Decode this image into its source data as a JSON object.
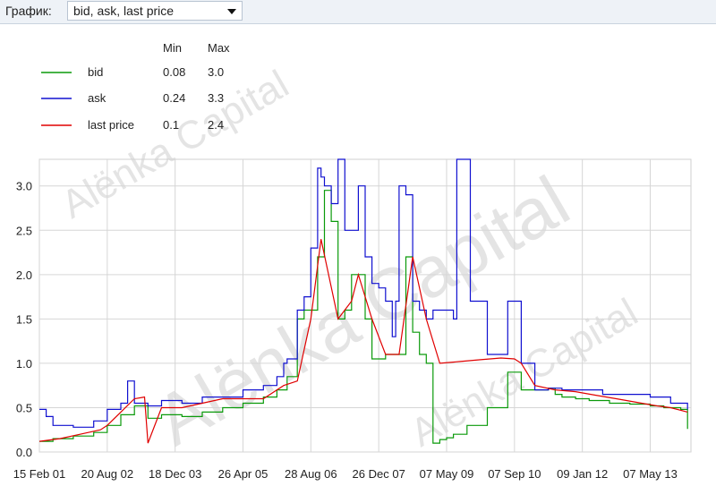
{
  "header": {
    "label": "График:",
    "selected": "bid, ask, last price"
  },
  "legend": {
    "min_header": "Min",
    "max_header": "Max",
    "rows": [
      {
        "name": "bid",
        "min": "0.08",
        "max": "3.0",
        "color": "#0a9a0a"
      },
      {
        "name": "ask",
        "min": "0.24",
        "max": "3.3",
        "color": "#1010d0"
      },
      {
        "name": "last price",
        "min": "0.1",
        "max": "2.4",
        "color": "#e00000"
      }
    ]
  },
  "watermark": "Alënka Capital",
  "chart_data": {
    "type": "line",
    "x_tick_labels": [
      "15 Feb 01",
      "20 Aug 02",
      "18 Dec 03",
      "26 Apr 05",
      "28 Aug 06",
      "26 Dec 07",
      "07 May 09",
      "07 Sep 10",
      "09 Jan 12",
      "07 May 13"
    ],
    "y_ticks": [
      0.0,
      0.5,
      1.0,
      1.5,
      2.0,
      2.5,
      3.0
    ],
    "y_tick_labels": [
      "0.0",
      "0.5",
      "1.0",
      "1.5",
      "2.0",
      "2.5",
      "3.0"
    ],
    "ylim": [
      0,
      3.3
    ],
    "xlim": [
      0,
      9.6
    ],
    "grid": true,
    "series": [
      {
        "name": "bid",
        "color": "#0a9a0a",
        "x": [
          0.0,
          0.2,
          0.5,
          0.8,
          1.0,
          1.2,
          1.4,
          1.6,
          1.8,
          2.1,
          2.4,
          2.7,
          3.0,
          3.3,
          3.5,
          3.65,
          3.8,
          3.9,
          4.0,
          4.1,
          4.2,
          4.3,
          4.4,
          4.5,
          4.6,
          4.7,
          4.8,
          4.9,
          5.0,
          5.1,
          5.2,
          5.3,
          5.4,
          5.5,
          5.6,
          5.7,
          5.8,
          5.9,
          6.0,
          6.1,
          6.3,
          6.6,
          6.9,
          7.1,
          7.3,
          7.5,
          7.6,
          7.7,
          7.9,
          8.1,
          8.4,
          8.7,
          9.0,
          9.2,
          9.45,
          9.55
        ],
        "y": [
          0.12,
          0.15,
          0.18,
          0.22,
          0.3,
          0.42,
          0.52,
          0.38,
          0.42,
          0.4,
          0.45,
          0.5,
          0.55,
          0.62,
          0.7,
          0.85,
          1.5,
          1.6,
          1.6,
          2.2,
          2.95,
          2.6,
          1.5,
          1.6,
          2.0,
          2.0,
          1.5,
          1.05,
          1.05,
          1.1,
          1.1,
          1.1,
          2.2,
          1.35,
          1.1,
          1.0,
          0.1,
          0.14,
          0.16,
          0.2,
          0.3,
          0.5,
          0.9,
          0.7,
          0.7,
          0.72,
          0.65,
          0.62,
          0.6,
          0.58,
          0.55,
          0.54,
          0.52,
          0.5,
          0.48,
          0.26
        ]
      },
      {
        "name": "ask",
        "color": "#1010d0",
        "x": [
          0.0,
          0.1,
          0.2,
          0.5,
          0.8,
          1.0,
          1.2,
          1.3,
          1.4,
          1.6,
          1.8,
          2.1,
          2.4,
          2.7,
          3.0,
          3.3,
          3.5,
          3.6,
          3.65,
          3.8,
          3.9,
          4.0,
          4.1,
          4.15,
          4.2,
          4.3,
          4.4,
          4.5,
          4.6,
          4.7,
          4.8,
          4.9,
          5.0,
          5.1,
          5.2,
          5.25,
          5.3,
          5.4,
          5.5,
          5.6,
          5.7,
          5.8,
          6.0,
          6.1,
          6.15,
          6.3,
          6.35,
          6.6,
          6.8,
          6.9,
          7.0,
          7.1,
          7.3,
          7.5,
          7.7,
          8.0,
          8.3,
          8.6,
          9.0,
          9.3,
          9.55
        ],
        "y": [
          0.48,
          0.4,
          0.3,
          0.28,
          0.35,
          0.48,
          0.55,
          0.8,
          0.55,
          0.52,
          0.58,
          0.55,
          0.62,
          0.62,
          0.7,
          0.75,
          0.85,
          1.0,
          1.05,
          1.6,
          1.75,
          2.3,
          3.2,
          3.1,
          3.0,
          2.8,
          3.3,
          2.5,
          2.5,
          3.0,
          2.2,
          1.9,
          1.85,
          1.7,
          1.3,
          1.7,
          3.0,
          2.9,
          1.7,
          1.6,
          1.5,
          1.6,
          1.6,
          1.5,
          3.3,
          3.3,
          1.7,
          1.1,
          1.1,
          1.7,
          1.7,
          1.0,
          0.7,
          0.72,
          0.7,
          0.7,
          0.65,
          0.65,
          0.62,
          0.55,
          0.48
        ]
      },
      {
        "name": "last price",
        "color": "#e00000",
        "x": [
          0.0,
          0.3,
          0.6,
          0.9,
          1.0,
          1.2,
          1.4,
          1.55,
          1.6,
          1.8,
          2.1,
          2.4,
          2.7,
          3.0,
          3.3,
          3.6,
          3.8,
          4.0,
          4.15,
          4.4,
          4.6,
          4.7,
          4.9,
          5.1,
          5.3,
          5.5,
          5.7,
          5.9,
          6.2,
          6.5,
          6.8,
          7.0,
          7.1,
          7.3,
          7.6,
          7.9,
          8.2,
          8.5,
          8.8,
          9.1,
          9.3,
          9.55
        ],
        "y": [
          0.12,
          0.15,
          0.2,
          0.25,
          0.3,
          0.45,
          0.6,
          0.62,
          0.1,
          0.5,
          0.5,
          0.55,
          0.6,
          0.6,
          0.6,
          0.75,
          0.8,
          1.5,
          2.4,
          1.5,
          1.7,
          2.0,
          1.5,
          1.1,
          1.1,
          2.2,
          1.5,
          1.0,
          1.02,
          1.04,
          1.06,
          1.05,
          1.0,
          0.75,
          0.7,
          0.68,
          0.64,
          0.6,
          0.56,
          0.52,
          0.5,
          0.45
        ]
      }
    ]
  }
}
